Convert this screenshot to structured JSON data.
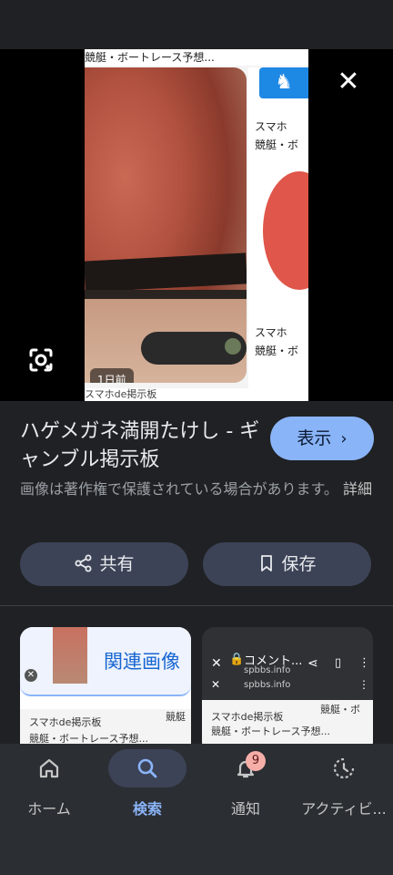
{
  "viewer": {
    "page_header": "競艇・ボートレース予想...",
    "time_chip": "1日前",
    "side_text_1": "スマホ",
    "side_text_2": "競艇・ボ",
    "side_text_3": "スマホ",
    "side_text_4": "競艇・ボ",
    "footer_text": "スマホde掲示板",
    "close_label": "✕"
  },
  "result": {
    "title": "ハゲメガネ満開たけし - ギャンブル掲示板",
    "show_button": "表示",
    "copyright_notice": "画像は著作権で保護されている場合があります。",
    "details_link": "詳細",
    "share_button": "共有",
    "save_button": "保存"
  },
  "related": {
    "card1_label": "関連画像",
    "card1_caption_1": "スマホde掲示板",
    "card1_caption_2": "競艇・ボートレース予想...",
    "card1_side": "競艇",
    "card2_title": "コメント...",
    "card2_url": "spbbs.info",
    "card2_url2": "spbbs.info",
    "card2_caption_1": "スマホde掲示板",
    "card2_caption_2": "競艇・ボートレース予想...",
    "card2_side": "競艇・ボ"
  },
  "nav": {
    "items": [
      {
        "label": "ホーム",
        "icon": "home-icon"
      },
      {
        "label": "検索",
        "icon": "search-icon"
      },
      {
        "label": "通知",
        "icon": "bell-icon"
      },
      {
        "label": "アクティビ...",
        "icon": "activity-icon"
      }
    ],
    "notification_count": "9",
    "active_color": "#8ab4f8",
    "active_pill_color": "#3c4356"
  }
}
